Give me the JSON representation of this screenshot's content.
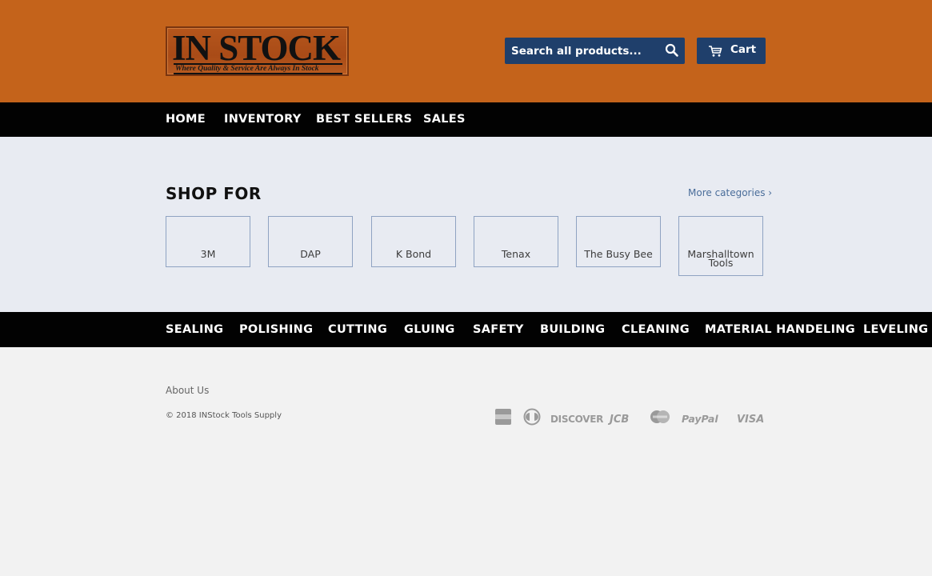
{
  "header": {
    "logo": {
      "main": "IN STOCK",
      "tagline": "Where Quality & Service Are Always In Stock"
    },
    "search": {
      "placeholder": "Search all products..."
    },
    "cart": {
      "label": "Cart"
    }
  },
  "nav": {
    "items": [
      "HOME",
      "INVENTORY",
      "BEST SELLERS",
      "SALES"
    ]
  },
  "shop": {
    "title": "SHOP FOR",
    "more_link": "More categories ›",
    "categories": [
      "3M",
      "DAP",
      "K Bond",
      "Tenax",
      "The Busy Bee",
      "Marshalltown Tools"
    ]
  },
  "category_bar": {
    "items": [
      "SEALING",
      "POLISHING",
      "CUTTING",
      "GLUING",
      "SAFETY",
      "BUILDING",
      "CLEANING",
      "MATERIAL HANDELING",
      "LEVELING"
    ]
  },
  "footer": {
    "about": "About Us",
    "copyright": "© 2018 INStock Tools Supply",
    "payment_icons": [
      "american-express-icon",
      "diners-club-icon",
      "discover-icon",
      "jcb-icon",
      "mastercard-icon",
      "paypal-icon",
      "visa-icon"
    ],
    "payment_labels": {
      "discover": "DISCOVER",
      "jcb": "JCB",
      "paypal": "PayPal",
      "visa": "VISA"
    }
  },
  "colors": {
    "header_bg": "#c4631b",
    "nav_bg": "#020202",
    "button_bg": "#1f3f6b",
    "shop_bg": "#e8ebf2",
    "link": "#4a6d9a"
  }
}
